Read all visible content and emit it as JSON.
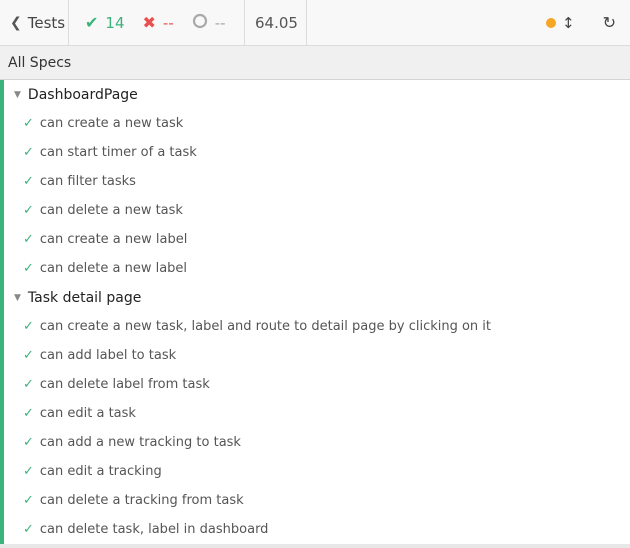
{
  "toolbar": {
    "back_label": "Tests",
    "passed": "14",
    "failed": "--",
    "pending": "--",
    "duration": "64.05"
  },
  "header": {
    "title": "All Specs"
  },
  "suites": [
    {
      "title": "DashboardPage",
      "tests": [
        "can create a new task",
        "can start timer of a task",
        "can filter tasks",
        "can delete a new task",
        "can create a new label",
        "can delete a new label"
      ]
    },
    {
      "title": "Task detail page",
      "tests": [
        "can create a new task, label and route to detail page by clicking on it",
        "can add label to task",
        "can delete label from task",
        "can edit a task",
        "can add a new tracking to task",
        "can edit a tracking",
        "can delete a tracking from task",
        "can delete task, label in dashboard"
      ]
    }
  ],
  "icons": {
    "back": "chevron-left-icon",
    "passed": "check-icon",
    "failed": "x-icon",
    "pending": "circle-icon",
    "status": "orange-dot-icon",
    "resize": "vertical-arrows-icon",
    "reload": "reload-icon",
    "collapse": "caret-down-icon"
  },
  "colors": {
    "passed": "#3bb37a",
    "failed": "#e94f4f",
    "pending": "#a9a9a9",
    "status_dot": "#f5a623"
  }
}
